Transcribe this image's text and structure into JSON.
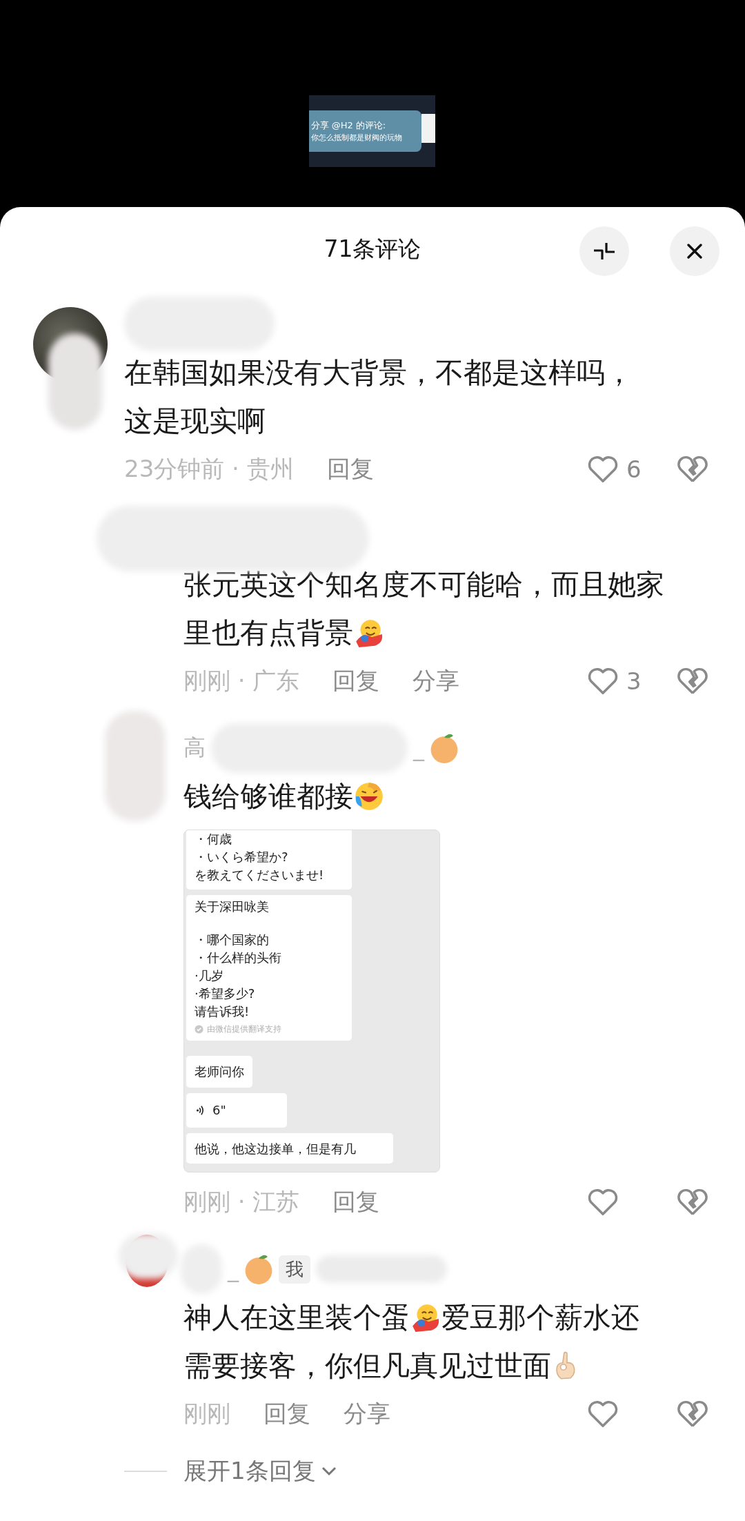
{
  "video_preview": {
    "lines": [
      "分享 @H2 的评论:",
      "你怎么抵制都是财阀的玩物"
    ]
  },
  "header": {
    "title": "71条评论"
  },
  "comments": [
    {
      "kind": "top",
      "lines": [
        [
          {
            "kind": "text",
            "text": "在韩国如果没有大背景，不都是这样吗，"
          }
        ],
        [
          {
            "kind": "text",
            "text": "这是现实啊"
          }
        ]
      ],
      "time": "23分钟前 · 贵州",
      "reply_label": "回复",
      "likes": "6"
    },
    {
      "kind": "reply",
      "lines": [
        [
          {
            "kind": "text",
            "text": "张元英这个知名度不可能哈，而且她家"
          }
        ],
        [
          {
            "kind": "text",
            "text": "里也有点背景"
          },
          {
            "kind": "hugging-emoji"
          }
        ]
      ],
      "time": "刚刚 · 广东",
      "reply_label": "回复",
      "share_label": "分享",
      "likes": "3"
    },
    {
      "kind": "reply",
      "name_start": "高",
      "name_end": "_",
      "orange_badge": true,
      "lines": [
        [
          {
            "kind": "text",
            "text": "钱给够谁都接"
          },
          {
            "kind": "laughing-emoji"
          }
        ]
      ],
      "screenshot": {
        "bubbles": [
          {
            "kind": "text",
            "lines": [
              "・何歳",
              "・いくら希望か?",
              "を教えてくださいませ!"
            ]
          },
          {
            "kind": "text",
            "heading": "关于深田咏美",
            "lines": [
              "・哪个国家的",
              "・什么样的头衔",
              "·几岁",
              "·希望多少?",
              "请告诉我!"
            ],
            "note": "由微信提供翻译支持"
          },
          {
            "kind": "text",
            "lines": [
              "老师问你"
            ]
          },
          {
            "kind": "voice",
            "lines": [
              "6\""
            ]
          },
          {
            "kind": "text",
            "lines": [
              "他说，他这边接单，但是有几"
            ]
          }
        ]
      },
      "time": "刚刚 · 江苏",
      "reply_label": "回复"
    },
    {
      "kind": "reply",
      "name_end": "_",
      "orange_badge": true,
      "author_tag": "我",
      "lines": [
        [
          {
            "kind": "text",
            "text": "神人在这里装个蛋"
          },
          {
            "kind": "hugging-emoji"
          },
          {
            "kind": "text",
            "text": "爱豆那个薪水还"
          }
        ],
        [
          {
            "kind": "text",
            "text": "需要接客，你但凡真见过世面"
          },
          {
            "kind": "ok-emoji"
          }
        ]
      ],
      "time": "刚刚",
      "reply_label": "回复",
      "share_label": "分享",
      "expand": "展开1条回复"
    }
  ]
}
